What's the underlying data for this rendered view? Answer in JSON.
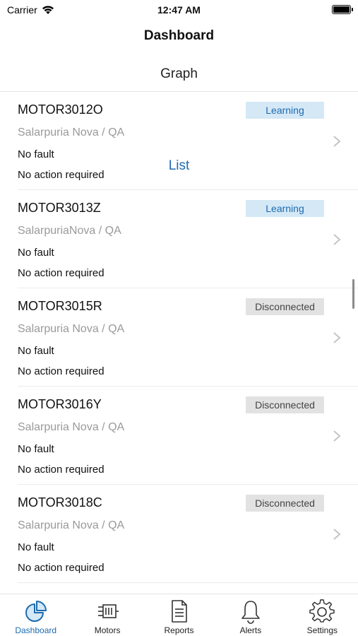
{
  "status_bar": {
    "carrier": "Carrier",
    "time": "12:47 AM"
  },
  "header": {
    "title": "Dashboard"
  },
  "tabs": [
    {
      "label": "Graph",
      "active": false
    },
    {
      "label": "List",
      "active": true
    }
  ],
  "motors": [
    {
      "name": "MOTOR3012O",
      "location": "Salarpuria Nova / QA",
      "fault": "No fault",
      "action": "No action required",
      "status": "Learning"
    },
    {
      "name": "MOTOR3013Z",
      "location": "SalarpuriaNova / QA",
      "fault": "No fault",
      "action": "No action required",
      "status": "Learning"
    },
    {
      "name": "MOTOR3015R",
      "location": "Salarpuria Nova / QA",
      "fault": "No fault",
      "action": "No action required",
      "status": "Disconnected"
    },
    {
      "name": "MOTOR3016Y",
      "location": "Salarpuria Nova / QA",
      "fault": "No fault",
      "action": "No action required",
      "status": "Disconnected"
    },
    {
      "name": "MOTOR3018C",
      "location": "Salarpuria Nova / QA",
      "fault": "No fault",
      "action": "No action required",
      "status": "Disconnected"
    }
  ],
  "tabbar": [
    {
      "label": "Dashboard",
      "icon": "dashboard-pie-icon",
      "active": true
    },
    {
      "label": "Motors",
      "icon": "motor-icon",
      "active": false
    },
    {
      "label": "Reports",
      "icon": "report-document-icon",
      "active": false
    },
    {
      "label": "Alerts",
      "icon": "bell-icon",
      "active": false
    },
    {
      "label": "Settings",
      "icon": "gear-icon",
      "active": false
    }
  ],
  "colors": {
    "accent": "#1c6bb0",
    "learning_bg": "#d4e8f6",
    "disconnected_bg": "#e2e2e2",
    "secondary_text": "#9a9a9a"
  }
}
